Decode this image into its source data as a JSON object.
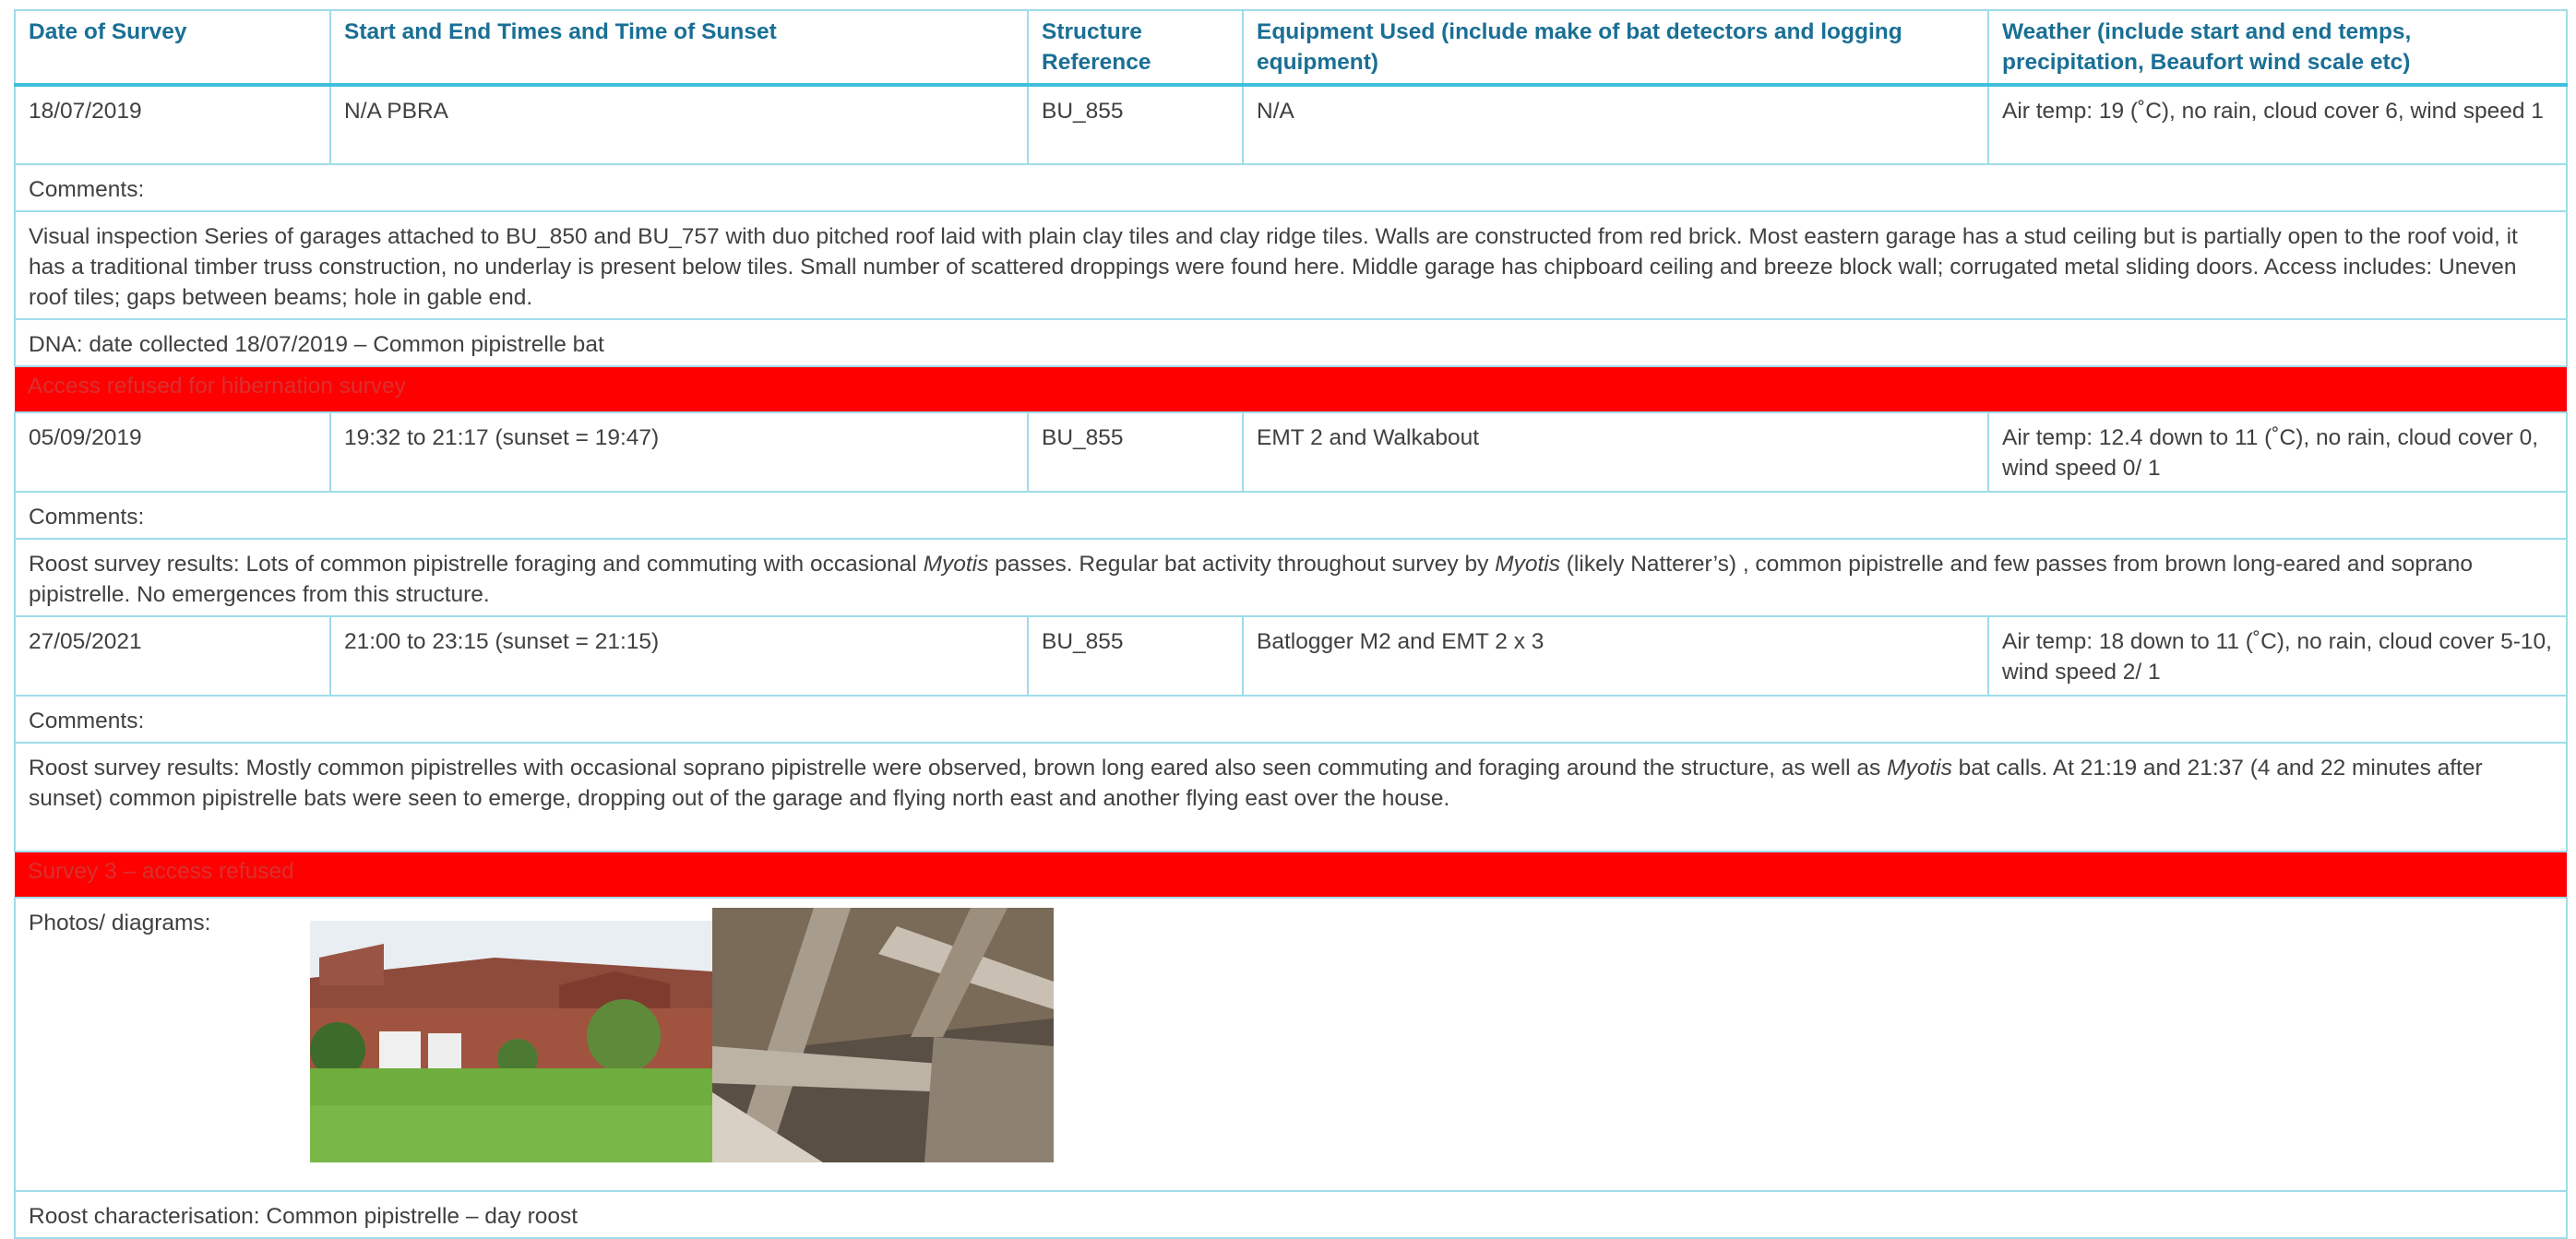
{
  "header": {
    "date": "Date of Survey",
    "times": "Start and End Times and Time of Sunset",
    "structure": "Structure Reference",
    "equipment": "Equipment Used (include make of bat detectors and logging equipment)",
    "weather": "Weather (include start and end temps, precipitation, Beaufort wind scale etc)"
  },
  "survey1": {
    "date": "18/07/2019",
    "times": "N/A PBRA",
    "structure": "BU_855",
    "equipment": "N/A",
    "weather": "Air temp: 19 (˚C), no rain, cloud cover 6, wind speed 1"
  },
  "comments_label": "Comments:",
  "survey1_comment": "Visual inspection Series of garages attached to BU_850 and BU_757 with duo pitched roof laid with plain clay tiles and clay ridge tiles. Walls are constructed from red brick. Most eastern garage has a stud ceiling but is partially open to the roof void, it has a traditional timber truss construction, no underlay is present below tiles. Small number of scattered droppings were found here. Middle garage has chipboard ceiling and breeze block wall; corrugated metal sliding doors. Access includes: Uneven roof tiles; gaps between beams; hole in gable end.",
  "dna": "DNA: date collected 18/07/2019 – Common pipistrelle bat",
  "refused1": "Access refused for hibernation survey",
  "survey2": {
    "date": "05/09/2019",
    "times": "19:32 to 21:17 (sunset = 19:47)",
    "structure": "BU_855",
    "equipment": "EMT 2 and Walkabout",
    "weather": "Air temp: 12.4 down to 11 (˚C), no rain, cloud cover 0, wind speed 0/ 1"
  },
  "survey2_comment": {
    "p1": "Roost survey results: Lots of common pipistrelle foraging and commuting with occasional ",
    "i1": "Myotis",
    "p2": " passes. Regular bat activity throughout survey by ",
    "i2": "Myotis",
    "p3": " (likely Natterer’s) , common pipistrelle and few passes from brown long-eared and soprano pipistrelle. No emergences from this structure."
  },
  "survey3": {
    "date": "27/05/2021",
    "times": "21:00 to 23:15 (sunset = 21:15)",
    "structure": "BU_855",
    "equipment": "Batlogger M2 and EMT 2 x 3",
    "weather": "Air temp: 18 down to 11 (˚C), no rain, cloud cover 5-10, wind speed 2/ 1"
  },
  "survey3_comment": {
    "p1": "Roost survey results: Mostly common pipistrelles with occasional soprano pipistrelle were observed, brown long eared also seen commuting and foraging around the structure, as well as ",
    "i1": "Myotis",
    "p2": " bat calls. At 21:19 and 21:37 (4 and 22 minutes after sunset) common pipistrelle bats were seen to emerge, dropping out of the garage and flying north east and another flying east over the house."
  },
  "refused2": "Survey 3 – access refused",
  "photos_label": "Photos/ diagrams:",
  "roost": "Roost characterisation: Common pipistrelle – day roost",
  "colors": {
    "header_text": "#1a6f95",
    "border": "#9fdcea",
    "alert": "#ff0000"
  }
}
